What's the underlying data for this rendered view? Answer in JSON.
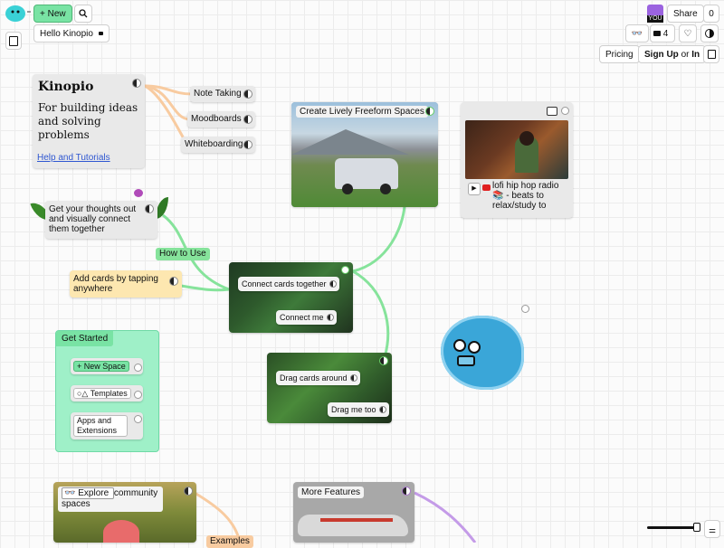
{
  "colors": {
    "accent_green": "#79e3a4",
    "connection_orange": "#f8cba0",
    "connection_green": "#86e39b",
    "connection_purple": "#c49be8",
    "yellow_card": "#fde7b0",
    "get_started_bg": "#9ff0c8"
  },
  "topbar": {
    "new_button_label": "+ New",
    "space_name": "Hello Kinopio",
    "share_label": "Share",
    "share_count": "0",
    "users_count": "4",
    "pricing_label": "Pricing",
    "signup_label": "Sign Up",
    "or_label": "or",
    "in_label": "In",
    "avatar_label": "YOU"
  },
  "cards": {
    "intro": {
      "title": "Kinopio",
      "body": "For building ideas and solving problems",
      "link": "Help and Tutorials"
    },
    "note_taking": "Note Taking",
    "moodboards": "Moodboards",
    "whiteboarding": "Whiteboarding",
    "freeform": "Create Lively Freeform Spaces",
    "lofi": "lofi hip hop radio 📚 - beats to relax/study to",
    "get_thoughts": "Get your thoughts out and visually connect them together",
    "how_to_use": "How to Use",
    "add_cards": "Add cards by tapping anywhere",
    "connect_cards": "Connect cards together",
    "connect_me": "Connect me",
    "drag_cards": "Drag cards around",
    "drag_me": "Drag me too",
    "get_started": {
      "title": "Get Started",
      "new_space": "+ New Space",
      "templates": "Templates",
      "apps": "Apps and Extensions"
    },
    "explore_button": "Explore",
    "explore_text": "community spaces",
    "examples": "Examples",
    "more_features": "More Features"
  }
}
